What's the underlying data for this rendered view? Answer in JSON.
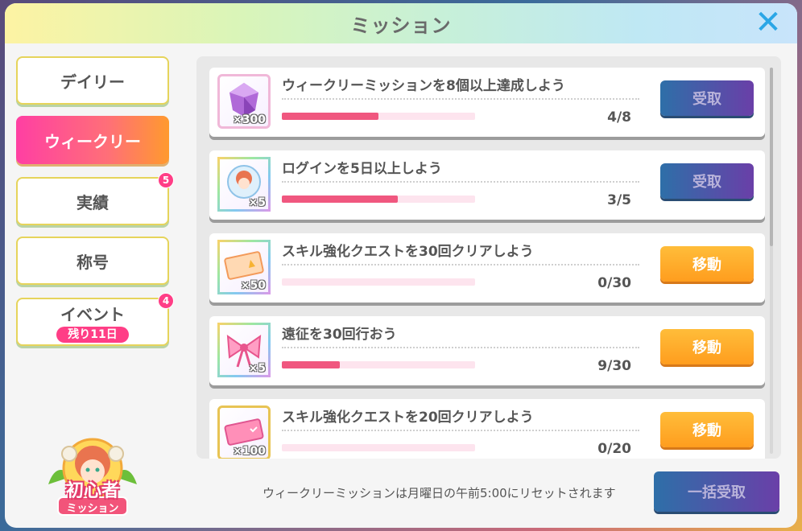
{
  "header": {
    "title": "ミッション",
    "close_icon": "close-icon"
  },
  "tabs": [
    {
      "label": "デイリー",
      "active": false
    },
    {
      "label": "ウィークリー",
      "active": true
    },
    {
      "label": "実績",
      "badge": "5"
    },
    {
      "label": "称号"
    },
    {
      "label": "イベント",
      "badge": "4",
      "sub": "残り11日"
    }
  ],
  "missions": [
    {
      "text": "ウィークリーミッションを8個以上達成しよう",
      "qty": "×300",
      "icon": "gem-icon",
      "progress": "4/8",
      "progress_fraction": 0.5,
      "button": "受取",
      "button_type": "receive"
    },
    {
      "text": "ログインを5日以上しよう",
      "qty": "×5",
      "icon": "character-ticket-icon",
      "progress": "3/5",
      "progress_fraction": 0.6,
      "button": "受取",
      "button_type": "receive"
    },
    {
      "text": "スキル強化クエストを30回クリアしよう",
      "qty": "×50",
      "icon": "skill-ticket-icon",
      "progress": "0/30",
      "progress_fraction": 0.0,
      "button": "移動",
      "button_type": "move"
    },
    {
      "text": "遠征を30回行おう",
      "qty": "×5",
      "icon": "ribbon-icon",
      "progress": "9/30",
      "progress_fraction": 0.3,
      "button": "移動",
      "button_type": "move"
    },
    {
      "text": "スキル強化クエストを20回クリアしよう",
      "qty": "×100",
      "icon": "ticket-icon",
      "progress": "0/20",
      "progress_fraction": 0.0,
      "button": "移動",
      "button_type": "move"
    }
  ],
  "footer": {
    "note": "ウィークリーミッションは月曜日の午前5:00にリセットされます",
    "bulk_button": "一括受取"
  },
  "beginner": {
    "title": "初心者",
    "sub": "ミッション"
  },
  "colors": {
    "accent_pink": "#ff3e86",
    "receive": "#2e6fa8",
    "move": "#ff9d1e",
    "progress": "#f0577f"
  }
}
